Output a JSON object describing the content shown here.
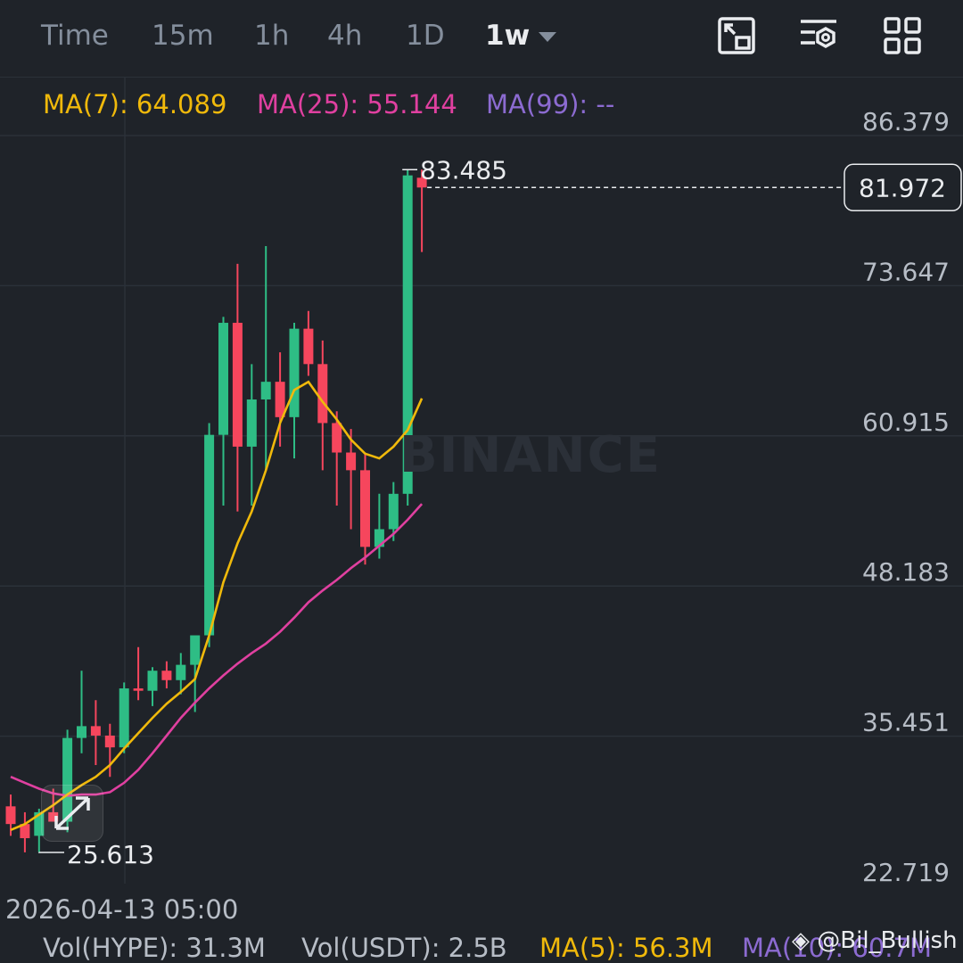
{
  "tabs": [
    {
      "label": "Time"
    },
    {
      "label": "15m"
    },
    {
      "label": "1h"
    },
    {
      "label": "4h"
    },
    {
      "label": "1D"
    },
    {
      "label": "1w",
      "active": true
    }
  ],
  "toolbar_icons": [
    "chart-in-box-icon",
    "indicator-settings-icon",
    "grid-layout-icon"
  ],
  "indicators": {
    "ma7": {
      "label": "MA(7): 64.089",
      "color": "#f0b90b"
    },
    "ma25": {
      "label": "MA(25): 55.144",
      "color": "#e040a0"
    },
    "ma99": {
      "label": "MA(99): --",
      "color": "#8c6bd1"
    }
  },
  "watermark": "BINANCE",
  "price_axis": [
    "86.379",
    "73.647",
    "60.915",
    "48.183",
    "35.451",
    "22.719"
  ],
  "high_label": "83.485",
  "low_label": "25.613",
  "last_price": "81.972",
  "date_label": "2026-04-13 05:00",
  "volume": {
    "vol_hype": "Vol(HYPE): 31.3M",
    "vol_usdt": "Vol(USDT): 2.5B",
    "ma5": "MA(5): 56.3M",
    "ma10": "MA(10): 60.7M"
  },
  "credit": "@Bil_Bullish",
  "colors": {
    "up": "#2ebd85",
    "down": "#f6465d",
    "bg": "#1f2329",
    "grid": "#2b3139"
  },
  "chart_data": {
    "type": "candlestick",
    "y_axis_ticks": [
      86.379,
      73.647,
      60.915,
      48.183,
      35.451,
      22.719
    ],
    "candles": [
      {
        "o": 29.5,
        "h": 30.5,
        "l": 27.0,
        "c": 28.0
      },
      {
        "o": 28.0,
        "h": 29.0,
        "l": 25.6,
        "c": 26.8
      },
      {
        "o": 27.0,
        "h": 29.3,
        "l": 25.613,
        "c": 29.0
      },
      {
        "o": 29.0,
        "h": 31.0,
        "l": 28.5,
        "c": 28.2
      },
      {
        "o": 28.2,
        "h": 36.0,
        "l": 27.3,
        "c": 35.3
      },
      {
        "o": 35.3,
        "h": 41.0,
        "l": 34.0,
        "c": 36.3
      },
      {
        "o": 36.3,
        "h": 38.5,
        "l": 33.0,
        "c": 35.5
      },
      {
        "o": 35.5,
        "h": 36.5,
        "l": 32.0,
        "c": 34.5
      },
      {
        "o": 34.5,
        "h": 40.0,
        "l": 34.0,
        "c": 39.5
      },
      {
        "o": 39.5,
        "h": 43.0,
        "l": 38.5,
        "c": 39.3
      },
      {
        "o": 39.3,
        "h": 41.3,
        "l": 38.0,
        "c": 41.0
      },
      {
        "o": 41.0,
        "h": 41.8,
        "l": 39.5,
        "c": 40.2
      },
      {
        "o": 40.2,
        "h": 42.5,
        "l": 39.0,
        "c": 41.5
      },
      {
        "o": 41.5,
        "h": 43.0,
        "l": 37.5,
        "c": 44.0
      },
      {
        "o": 44.0,
        "h": 62.0,
        "l": 43.0,
        "c": 61.0
      },
      {
        "o": 61.0,
        "h": 71.0,
        "l": 55.0,
        "c": 70.5
      },
      {
        "o": 70.5,
        "h": 75.5,
        "l": 54.5,
        "c": 60.0
      },
      {
        "o": 60.0,
        "h": 67.0,
        "l": 55.0,
        "c": 64.0
      },
      {
        "o": 64.0,
        "h": 77.0,
        "l": 58.0,
        "c": 65.5
      },
      {
        "o": 65.5,
        "h": 68.0,
        "l": 60.0,
        "c": 62.5
      },
      {
        "o": 62.5,
        "h": 70.5,
        "l": 59.0,
        "c": 70.0
      },
      {
        "o": 70.0,
        "h": 71.5,
        "l": 66.0,
        "c": 67.0
      },
      {
        "o": 67.0,
        "h": 69.0,
        "l": 58.0,
        "c": 62.0
      },
      {
        "o": 62.0,
        "h": 63.0,
        "l": 55.0,
        "c": 59.5
      },
      {
        "o": 59.5,
        "h": 61.5,
        "l": 53.0,
        "c": 58.0
      },
      {
        "o": 58.0,
        "h": 59.5,
        "l": 50.0,
        "c": 51.5
      },
      {
        "o": 51.5,
        "h": 56.0,
        "l": 50.5,
        "c": 53.0
      },
      {
        "o": 53.0,
        "h": 57.0,
        "l": 52.0,
        "c": 56.0
      },
      {
        "o": 56.0,
        "h": 83.485,
        "l": 55.0,
        "c": 83.0
      },
      {
        "o": 82.8,
        "h": 83.485,
        "l": 76.5,
        "c": 81.972
      }
    ],
    "ma7": [
      27.5,
      28.0,
      28.8,
      29.6,
      30.5,
      31.3,
      32.0,
      33.0,
      34.4,
      35.7,
      37.0,
      38.2,
      39.2,
      40.3,
      44.0,
      48.5,
      51.8,
      54.5,
      58.0,
      62.0,
      64.8,
      65.5,
      63.8,
      62.3,
      60.6,
      59.4,
      59.0,
      60.0,
      61.4,
      64.089
    ],
    "ma25": [
      32.0,
      31.5,
      31.0,
      30.6,
      30.4,
      30.5,
      30.5,
      30.7,
      31.5,
      32.6,
      34.0,
      35.5,
      37.0,
      38.3,
      39.5,
      40.6,
      41.6,
      42.5,
      43.3,
      44.3,
      45.5,
      46.8,
      47.8,
      48.7,
      49.7,
      50.6,
      51.6,
      52.6,
      53.8,
      55.144
    ]
  }
}
